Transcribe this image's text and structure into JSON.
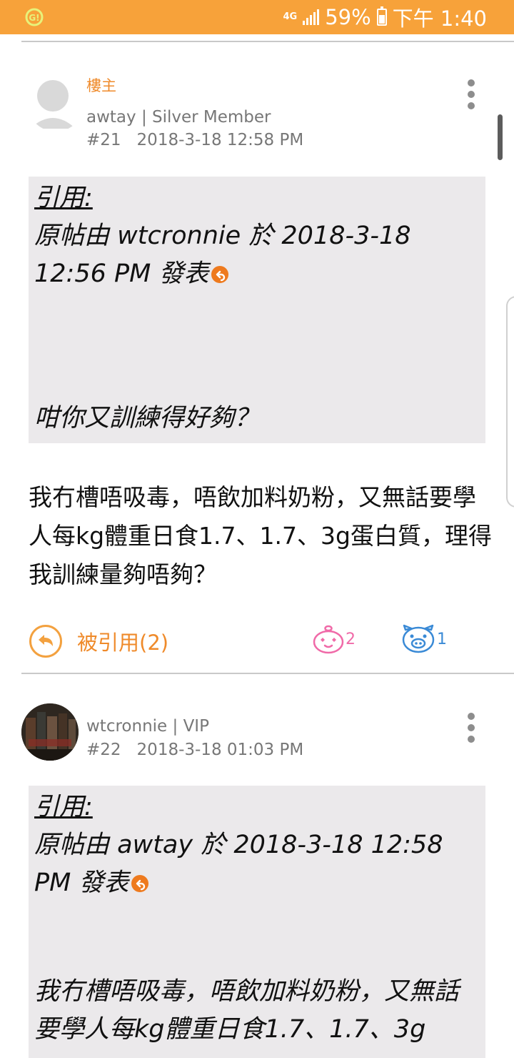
{
  "status_bar": {
    "network": "4G",
    "battery": "59%",
    "battery_level": 0.59,
    "time": "下午 1:40",
    "notification_icon": "app-notification-icon"
  },
  "posts": [
    {
      "author_tag": "樓主",
      "author_line": "awtay | Silver Member",
      "number": "#21",
      "datetime": "2018-3-18 12:58 PM",
      "quote": {
        "label": "引用:",
        "header": "原帖由 wtcronnie 於 2018-3-18 12:56 PM 發表",
        "text": "咁你又訓練得好夠？"
      },
      "body": "我冇槽唔吸毒，唔飲加料奶粉，又無話要學人每kg體重日食1.7、1.7、3g蛋白質，理得我訓練量夠唔夠？",
      "quoted_label": "被引用(2)",
      "reactions": [
        {
          "icon": "love-face-icon",
          "count": "2",
          "color": "#f06aa8"
        },
        {
          "icon": "pig-face-icon",
          "count": "1",
          "color": "#3a8ad6"
        }
      ]
    },
    {
      "author_line": "wtcronnie | VIP",
      "number": "#22",
      "datetime": "2018-3-18 01:03 PM",
      "quote": {
        "label": "引用:",
        "header": "原帖由 awtay 於 2018-3-18 12:58 PM 發表",
        "text": "我冇槽唔吸毒，唔飲加料奶粉，又無話要學人每kg體重日食1.7、1.7、3g"
      }
    }
  ]
}
